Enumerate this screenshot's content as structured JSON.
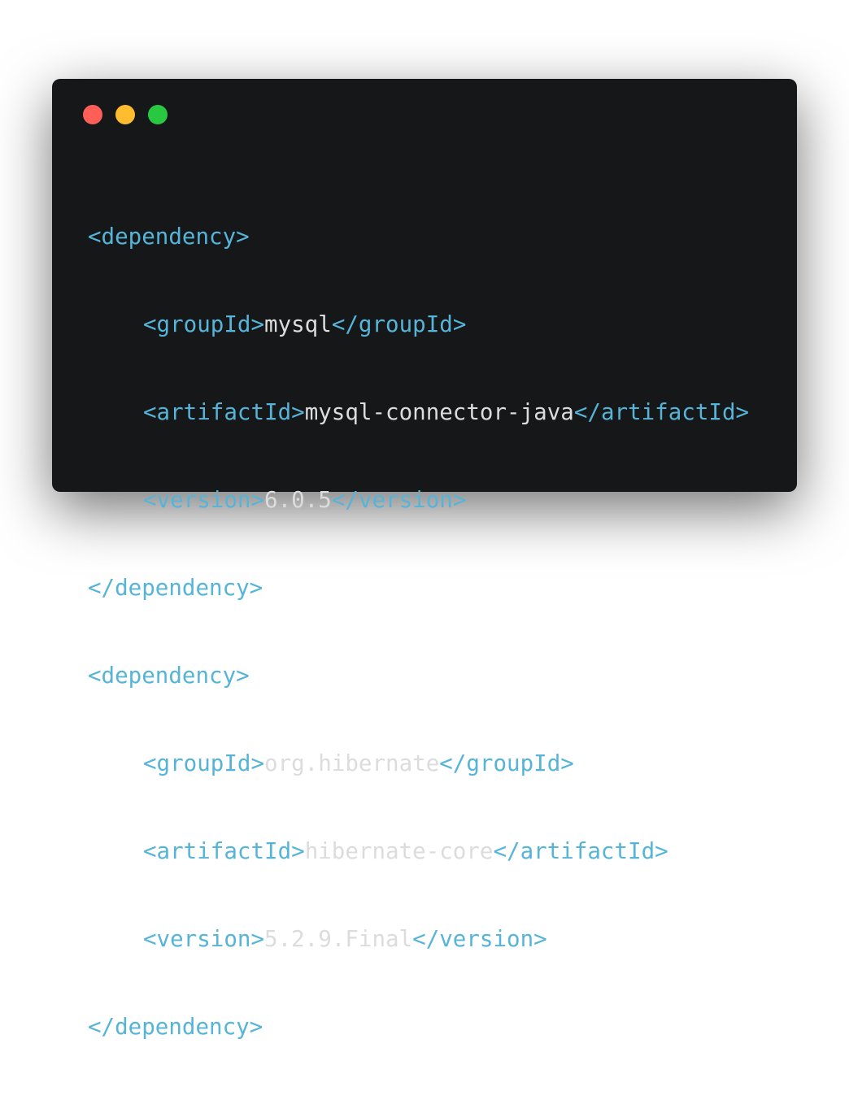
{
  "window": {
    "controls": [
      {
        "name": "close",
        "color": "#ff5f57",
        "icon": "close-dot-icon"
      },
      {
        "name": "minimize",
        "color": "#febc2e",
        "icon": "minimize-dot-icon"
      },
      {
        "name": "zoom",
        "color": "#28c840",
        "icon": "zoom-dot-icon"
      }
    ]
  },
  "colors": {
    "window_bg": "#161719",
    "tag": "#56b4d8",
    "text": "#dcdcdc"
  },
  "code": {
    "lines": [
      {
        "open": "<dependency>"
      },
      {
        "open": "<groupId>",
        "value": "mysql",
        "close": "</groupId>"
      },
      {
        "open": "<artifactId>",
        "value": "mysql-connector-java",
        "close": "</artifactId>"
      },
      {
        "open": "<version>",
        "value": "6.0.5",
        "close": "</version>"
      },
      {
        "close": "</dependency>"
      },
      {
        "open": "<dependency>"
      },
      {
        "open": "<groupId>",
        "value": "org.hibernate",
        "close": "</groupId>"
      },
      {
        "open": "<artifactId>",
        "value": "hibernate-core",
        "close": "</artifactId>"
      },
      {
        "open": "<version>",
        "value": "5.2.9.Final",
        "close": "</version>"
      },
      {
        "close": "</dependency>"
      }
    ]
  }
}
